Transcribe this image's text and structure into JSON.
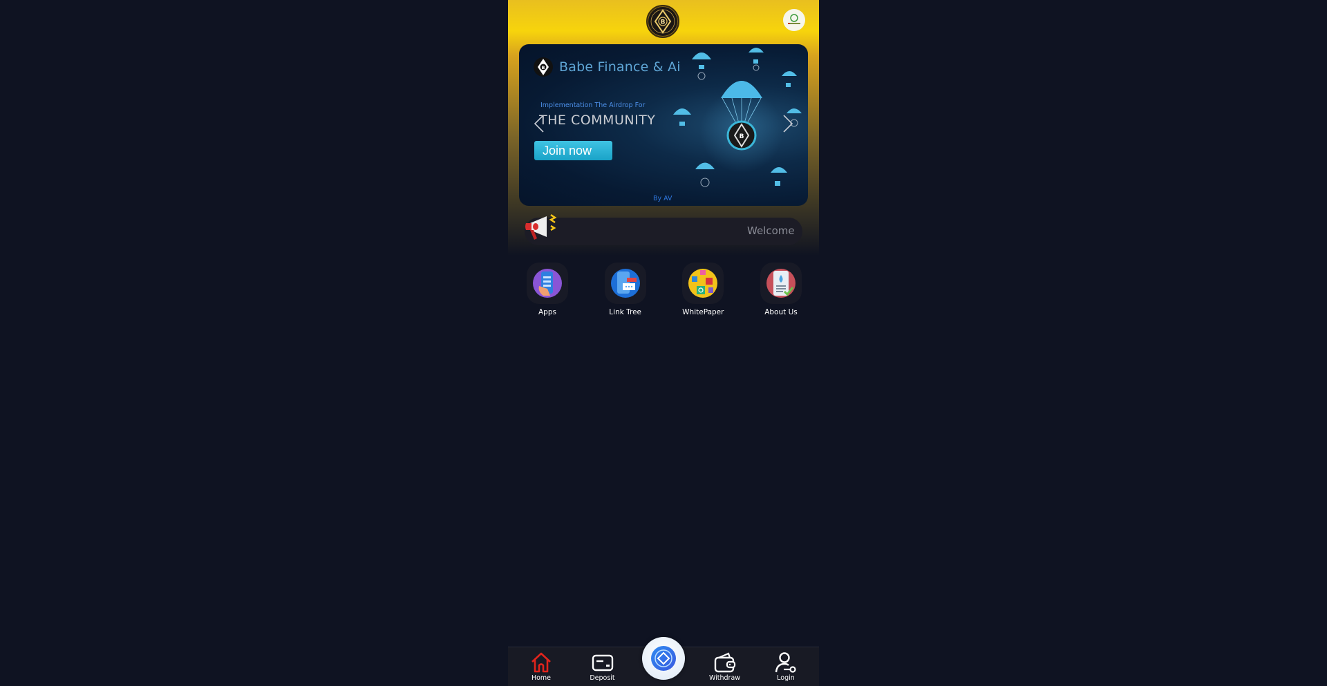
{
  "header": {
    "logo_icon": "babe-coin-logo-icon",
    "avatar_icon": "partner-logo-icon"
  },
  "banner": {
    "brand": "Babe Finance & Ai",
    "subtitle": "Implementation The Airdrop For",
    "headline": "THE COMMUNITY",
    "cta_label": "Join now",
    "credit": "By AV",
    "prev_icon": "chevron-left-icon",
    "next_icon": "chevron-right-icon"
  },
  "notice": {
    "icon": "megaphone-icon",
    "text": "Welcome"
  },
  "quick_links": [
    {
      "label": "Apps",
      "icon": "phone-apps-icon"
    },
    {
      "label": "Link Tree",
      "icon": "link-tree-icon"
    },
    {
      "label": "WhitePaper",
      "icon": "whitepaper-icon"
    },
    {
      "label": "About Us",
      "icon": "about-us-icon"
    }
  ],
  "bottom_nav": {
    "items": [
      {
        "label": "Home",
        "icon": "home-icon",
        "active": true
      },
      {
        "label": "Deposit",
        "icon": "card-icon"
      },
      {
        "label": "Withdraw",
        "icon": "wallet-icon"
      },
      {
        "label": "Login",
        "icon": "user-key-icon"
      }
    ],
    "center_icon": "coin-diamond-icon"
  },
  "colors": {
    "accent_yellow": "#f7d40c",
    "background": "#0f1322",
    "active_nav": "#e0241c",
    "cta": "#2bb6d8"
  }
}
